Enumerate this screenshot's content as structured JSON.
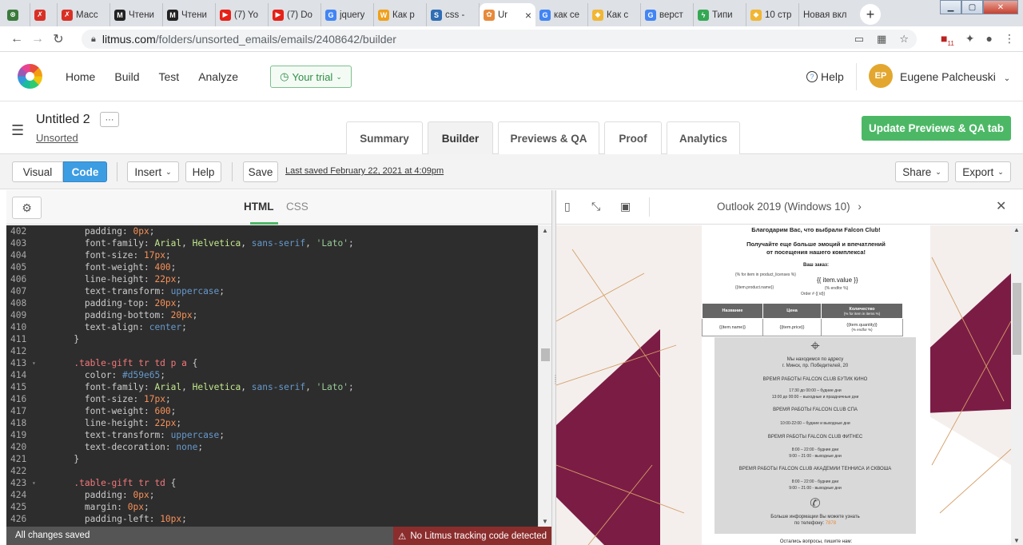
{
  "browser": {
    "tabs": [
      {
        "title": "",
        "fav_color": "#3b7a3b",
        "fav_glyph": "⊗"
      },
      {
        "title": "",
        "fav_color": "#d93025",
        "fav_glyph": "✗"
      },
      {
        "title": "Масс",
        "fav_color": "#d93025",
        "fav_glyph": "✗"
      },
      {
        "title": "Чтени",
        "fav_color": "#222",
        "fav_glyph": "M"
      },
      {
        "title": "Чтени",
        "fav_color": "#222",
        "fav_glyph": "M"
      },
      {
        "title": "(7) Yo",
        "fav_color": "#e62117",
        "fav_glyph": "▶"
      },
      {
        "title": "(7) Do",
        "fav_color": "#e62117",
        "fav_glyph": "▶"
      },
      {
        "title": "jquery",
        "fav_color": "#4285f4",
        "fav_glyph": "G"
      },
      {
        "title": "Как р",
        "fav_color": "#f0a01a",
        "fav_glyph": "W"
      },
      {
        "title": "css - ",
        "fav_color": "#2f6db5",
        "fav_glyph": "S"
      },
      {
        "title": "Ur",
        "fav_color": "#e8893a",
        "fav_glyph": "✿",
        "active": true
      },
      {
        "title": "как се",
        "fav_color": "#4285f4",
        "fav_glyph": "G"
      },
      {
        "title": "Как с",
        "fav_color": "#f2b632",
        "fav_glyph": "◆"
      },
      {
        "title": "верст",
        "fav_color": "#4285f4",
        "fav_glyph": "G"
      },
      {
        "title": "Типи",
        "fav_color": "#34a853",
        "fav_glyph": "ϟ"
      },
      {
        "title": "10 стр",
        "fav_color": "#f2b632",
        "fav_glyph": "◆"
      },
      {
        "title": "Новая вкл",
        "fav_color": "",
        "fav_glyph": ""
      }
    ],
    "url_host": "litmus.com",
    "url_path": "/folders/unsorted_emails/emails/2408642/builder",
    "ext_badge": "11"
  },
  "app": {
    "nav": [
      "Home",
      "Build",
      "Test",
      "Analyze"
    ],
    "trial": "Your trial",
    "help": "Help",
    "user_initials": "EP",
    "user_name": "Eugene Palcheuski"
  },
  "doc": {
    "title": "Untitled 2",
    "more": "···",
    "folder": "Unsorted",
    "tabs": [
      "Summary",
      "Builder",
      "Previews & QA",
      "Proof",
      "Analytics"
    ],
    "update_button": "Update Previews & QA tab"
  },
  "toolbar": {
    "visual": "Visual",
    "code": "Code",
    "insert": "Insert",
    "help": "Help",
    "save": "Save",
    "last_saved": "Last saved February 22, 2021 at 4:09pm",
    "share": "Share",
    "export": "Export"
  },
  "editor": {
    "tab_html": "HTML",
    "tab_css": "CSS",
    "status_left": "All changes saved",
    "status_right": "No Litmus tracking code detected"
  },
  "code_lines": [
    {
      "n": "402",
      "t": [
        [
          "p",
          "        padding: "
        ],
        [
          "v",
          "0px"
        ],
        [
          "p",
          ";"
        ]
      ]
    },
    {
      "n": "403",
      "t": [
        [
          "p",
          "        font-family: "
        ],
        [
          "green",
          "Arial"
        ],
        [
          "p",
          ", "
        ],
        [
          "green",
          "Helvetica"
        ],
        [
          "p",
          ", "
        ],
        [
          "q",
          "sans-serif"
        ],
        [
          "p",
          ", "
        ],
        [
          "s",
          "'Lato'"
        ],
        [
          "p",
          ";"
        ]
      ]
    },
    {
      "n": "404",
      "t": [
        [
          "p",
          "        font-size: "
        ],
        [
          "v",
          "17px"
        ],
        [
          "p",
          ";"
        ]
      ]
    },
    {
      "n": "405",
      "t": [
        [
          "p",
          "        font-weight: "
        ],
        [
          "v",
          "400"
        ],
        [
          "p",
          ";"
        ]
      ]
    },
    {
      "n": "406",
      "t": [
        [
          "p",
          "        line-height: "
        ],
        [
          "v",
          "22px"
        ],
        [
          "p",
          ";"
        ]
      ]
    },
    {
      "n": "407",
      "t": [
        [
          "p",
          "        text-transform: "
        ],
        [
          "q",
          "uppercase"
        ],
        [
          "p",
          ";"
        ]
      ]
    },
    {
      "n": "408",
      "t": [
        [
          "p",
          "        padding-top: "
        ],
        [
          "v",
          "20px"
        ],
        [
          "p",
          ";"
        ]
      ]
    },
    {
      "n": "409",
      "t": [
        [
          "p",
          "        padding-bottom: "
        ],
        [
          "v",
          "20px"
        ],
        [
          "p",
          ";"
        ]
      ]
    },
    {
      "n": "410",
      "t": [
        [
          "p",
          "        text-align: "
        ],
        [
          "q",
          "center"
        ],
        [
          "p",
          ";"
        ]
      ]
    },
    {
      "n": "411",
      "t": [
        [
          "p",
          "      }"
        ]
      ]
    },
    {
      "n": "412",
      "t": []
    },
    {
      "n": "413",
      "fold": true,
      "t": [
        [
          "sel",
          "      .table-gift tr td p a "
        ],
        [
          "p",
          "{"
        ]
      ]
    },
    {
      "n": "414",
      "t": [
        [
          "p",
          "        color: "
        ],
        [
          "q",
          "#d59e65"
        ],
        [
          "p",
          ";"
        ]
      ]
    },
    {
      "n": "415",
      "t": [
        [
          "p",
          "        font-family: "
        ],
        [
          "green",
          "Arial"
        ],
        [
          "p",
          ", "
        ],
        [
          "green",
          "Helvetica"
        ],
        [
          "p",
          ", "
        ],
        [
          "q",
          "sans-serif"
        ],
        [
          "p",
          ", "
        ],
        [
          "s",
          "'Lato'"
        ],
        [
          "p",
          ";"
        ]
      ]
    },
    {
      "n": "416",
      "t": [
        [
          "p",
          "        font-size: "
        ],
        [
          "v",
          "17px"
        ],
        [
          "p",
          ";"
        ]
      ]
    },
    {
      "n": "417",
      "t": [
        [
          "p",
          "        font-weight: "
        ],
        [
          "v",
          "600"
        ],
        [
          "p",
          ";"
        ]
      ]
    },
    {
      "n": "418",
      "t": [
        [
          "p",
          "        line-height: "
        ],
        [
          "v",
          "22px"
        ],
        [
          "p",
          ";"
        ]
      ]
    },
    {
      "n": "419",
      "t": [
        [
          "p",
          "        text-transform: "
        ],
        [
          "q",
          "uppercase"
        ],
        [
          "p",
          ";"
        ]
      ]
    },
    {
      "n": "420",
      "t": [
        [
          "p",
          "        text-decoration: "
        ],
        [
          "q",
          "none"
        ],
        [
          "p",
          ";"
        ]
      ]
    },
    {
      "n": "421",
      "t": [
        [
          "p",
          "      }"
        ]
      ]
    },
    {
      "n": "422",
      "t": []
    },
    {
      "n": "423",
      "fold": true,
      "t": [
        [
          "sel",
          "      .table-gift tr td "
        ],
        [
          "p",
          "{"
        ]
      ]
    },
    {
      "n": "424",
      "t": [
        [
          "p",
          "        padding: "
        ],
        [
          "v",
          "0px"
        ],
        [
          "p",
          ";"
        ]
      ]
    },
    {
      "n": "425",
      "t": [
        [
          "p",
          "        margin: "
        ],
        [
          "v",
          "0px"
        ],
        [
          "p",
          ";"
        ]
      ]
    },
    {
      "n": "426",
      "t": [
        [
          "p",
          "        padding-left: "
        ],
        [
          "v",
          "10px"
        ],
        [
          "p",
          ";"
        ]
      ]
    }
  ],
  "preview": {
    "client": "Outlook 2019 (Windows 10)",
    "email": {
      "line1": "Благодарим Вас, что выбрали Falcon Club!",
      "line2": "Получайте еще больше эмоций и впечатлений",
      "line3": "от посещения нашего комплекса!",
      "order_heading": "Ваш заказ:",
      "loop1": "{% for item in product_licenses %}",
      "item_value": "{{ item.value }}",
      "product_name": "{{item.product.name}}",
      "endfor1": "{% endfor %}",
      "order_no": "Order # {{ id}}",
      "th_name": "Название",
      "th_price": "Цена",
      "th_qty": "Количество",
      "th_loop": "{% for item in items %}",
      "td_name": "{{item.name}}",
      "td_price": "{{item.price}}",
      "td_qty": "{{item.quantity}}",
      "td_endfor": "{% endfor %}",
      "address1": "Мы находимся по адресу",
      "address2": "г. Минск, пр. Победителей, 20",
      "hours1_title": "ВРЕМЯ РАБОТЫ FALCON CLUB БУТИК КИНО",
      "hours1_a": "17:30 до 00:00 – будние дни",
      "hours1_b": "13:00 до 00:00 – выходные и праздничные дни",
      "hours2_title": "ВРЕМЯ РАБОТЫ FALCON CLUB СПА",
      "hours2_a": "10:00-22:00 – будние и выходные дни",
      "hours3_title": "ВРЕМЯ РАБОТЫ FALCON CLUB ФИТНЕС",
      "hours3_a": "8:00 – 22:00 - будние дни",
      "hours3_b": "9:00 – 21:00 - выходные дни",
      "hours4_title": "ВРЕМЯ РАБОТЫ FALCON CLUB АКАДЕМИИ ТЕННИСА И СКВОША",
      "hours4_a": "8:00 – 22:00 - будние дни",
      "hours4_b": "9:00 – 21:00 - выходные дни",
      "phone1": "Больше информации Вы можете узнать",
      "phone2_prefix": "по телефону: ",
      "phone2_number": "7878",
      "footer": "Остались вопросы, пишите нам:"
    }
  }
}
